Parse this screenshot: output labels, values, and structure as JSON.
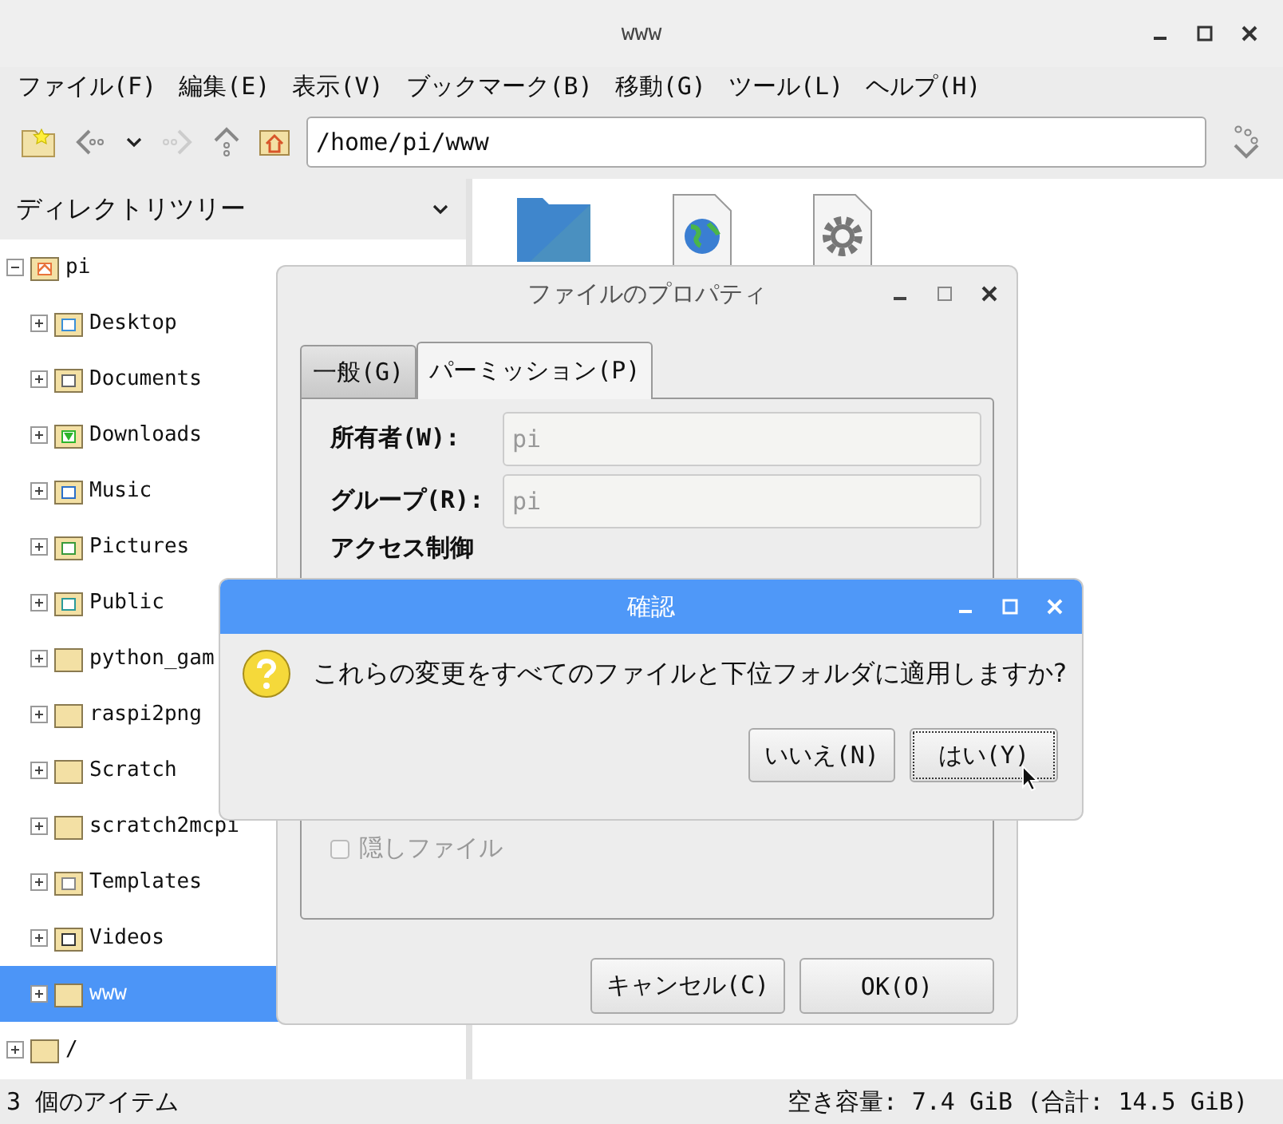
{
  "window": {
    "title": "www"
  },
  "menu": [
    "ファイル(F)",
    "編集(E)",
    "表示(V)",
    "ブックマーク(B)",
    "移動(G)",
    "ツール(L)",
    "ヘルプ(H)"
  ],
  "toolbar": {
    "path": "/home/pi/www",
    "back_disabled": false,
    "forward_disabled": true
  },
  "sidebar": {
    "header": "ディレクトリツリー",
    "tree": [
      {
        "label": "pi",
        "kind": "home",
        "expanded": true,
        "selected": false,
        "children": [
          {
            "label": "Desktop",
            "kind": "desktop",
            "expanded": false,
            "selected": false
          },
          {
            "label": "Documents",
            "kind": "documents",
            "expanded": false,
            "selected": false
          },
          {
            "label": "Downloads",
            "kind": "downloads",
            "expanded": false,
            "selected": false
          },
          {
            "label": "Music",
            "kind": "music",
            "expanded": false,
            "selected": false
          },
          {
            "label": "Pictures",
            "kind": "pictures",
            "expanded": false,
            "selected": false
          },
          {
            "label": "Public",
            "kind": "public",
            "expanded": false,
            "selected": false
          },
          {
            "label": "python_gam",
            "kind": "folder",
            "expanded": false,
            "selected": false
          },
          {
            "label": "raspi2png",
            "kind": "folder",
            "expanded": false,
            "selected": false
          },
          {
            "label": "Scratch",
            "kind": "folder",
            "expanded": false,
            "selected": false
          },
          {
            "label": "scratch2mcpi",
            "kind": "folder",
            "expanded": false,
            "selected": false
          },
          {
            "label": "Templates",
            "kind": "templates",
            "expanded": false,
            "selected": false
          },
          {
            "label": "Videos",
            "kind": "videos",
            "expanded": false,
            "selected": false
          },
          {
            "label": "www",
            "kind": "folder",
            "expanded": false,
            "selected": true
          }
        ]
      },
      {
        "label": "/",
        "kind": "folder",
        "expanded": false,
        "selected": false
      }
    ]
  },
  "files": [
    {
      "kind": "folder"
    },
    {
      "kind": "html"
    },
    {
      "kind": "settings"
    }
  ],
  "status_bar": {
    "items": "3 個のアイテム",
    "free_space": "空き容量: 7.4 GiB (合計: 14.5 GiB)"
  },
  "properties_dialog": {
    "title": "ファイルのプロパティ",
    "tabs": [
      {
        "label": "一般(G)",
        "selected": false
      },
      {
        "label": "パーミッション(P)",
        "selected": true
      }
    ],
    "fields": [
      {
        "label": "所有者(W):",
        "value": "pi",
        "disabled": true
      },
      {
        "label": "グループ(R):",
        "value": "pi",
        "disabled": true
      }
    ],
    "section": "アクセス制御",
    "checkbox": {
      "label": "隠しファイル",
      "checked": false,
      "disabled": true
    },
    "buttons": [
      "キャンセル(C)",
      "OK(O)"
    ]
  },
  "confirm_dialog": {
    "title": "確認",
    "message": "これらの変更をすべてのファイルと下位フォルダに適用しますか?",
    "buttons": [
      {
        "label": "いいえ(N)",
        "focused": false
      },
      {
        "label": "はい(Y)",
        "focused": true
      }
    ]
  }
}
